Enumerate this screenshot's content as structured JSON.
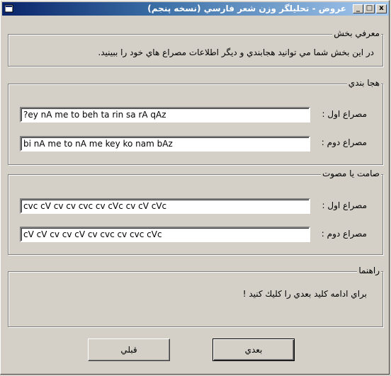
{
  "window": {
    "title": "عروض - تحليلگر وزن شعر فارسي (نسخه پنجم)",
    "minimize_label": "_",
    "maximize_label": "□",
    "close_label": "x"
  },
  "intro": {
    "legend": "معرفي بخش",
    "text": "در اين بخش شما مي توانيد هجابندي و ديگر اطلاعات مصراع هاي خود را ببينيد."
  },
  "syllables": {
    "legend": "هجا بندي",
    "first_label": "مصراع اول :",
    "first_value": "?ey nA me to beh ta rin sa rA qAz",
    "second_label": "مصراع دوم :",
    "second_value": "bi nA me to nA me key ko nam bAz"
  },
  "phones": {
    "legend": "صامت يا مصوت",
    "first_label": "مصراع اول :",
    "first_value": "cvc cV cv cv cvc cv cVc cv cV cVc",
    "second_label": "مصراع دوم :",
    "second_value": "cV cV cv cv cV cv cvc cv cvc cVc"
  },
  "guide": {
    "legend": "راهنما",
    "text": "براي ادامه كليد بعدي را كليك كنيد !"
  },
  "buttons": {
    "next": "بعدي",
    "prev": "قبلي"
  }
}
